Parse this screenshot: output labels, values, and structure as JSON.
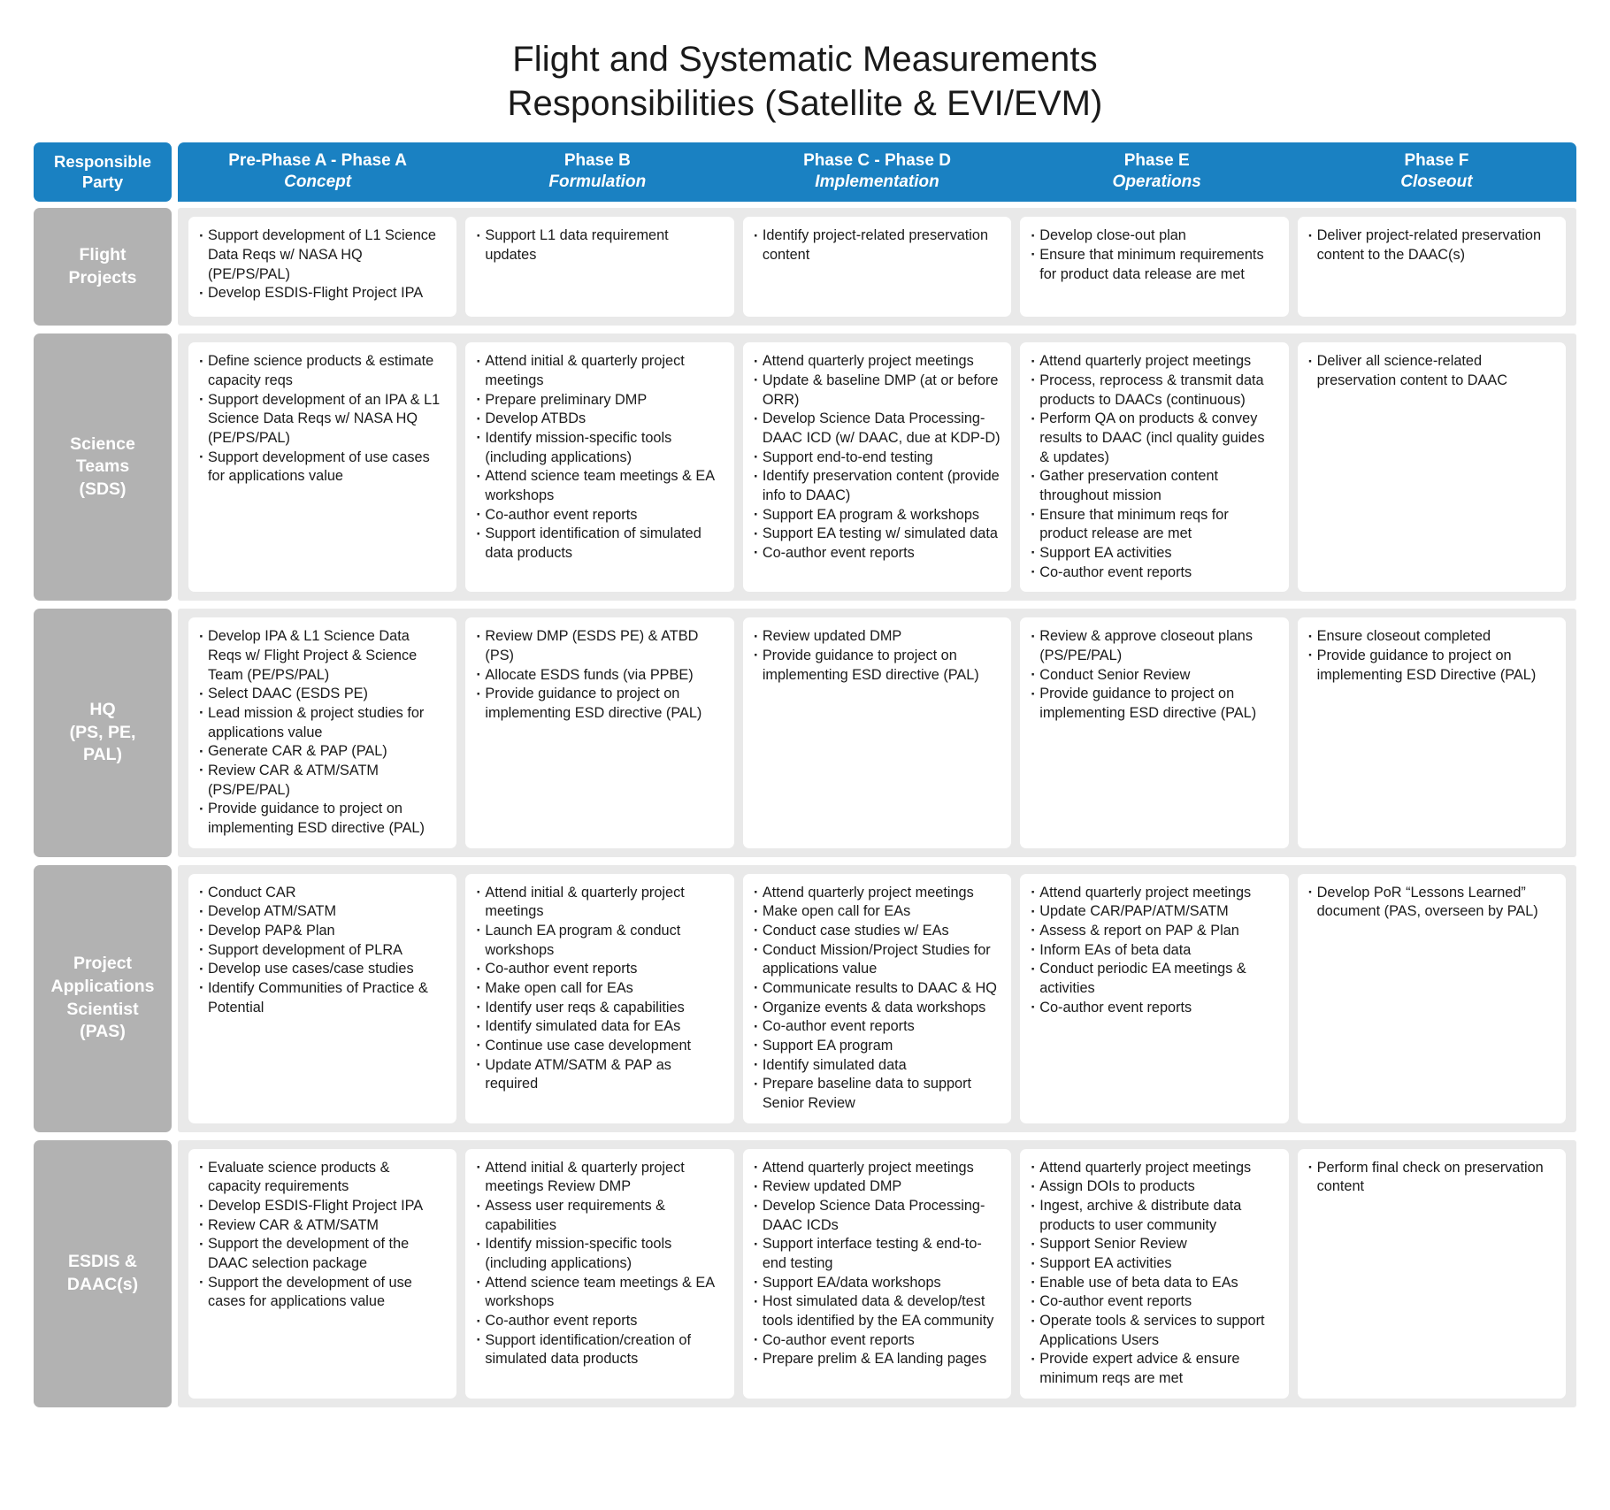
{
  "title": {
    "line1": "Flight and Systematic Measurements",
    "line2": "Responsibilities (Satellite & EVI/EVM)"
  },
  "colors": {
    "header_blue": "#1a81c2",
    "row_label_gray": "#b2b2b2",
    "cell_band_gray": "#e9e9e9",
    "cell_white": "#ffffff",
    "text_dark": "#1a1a1a"
  },
  "header": {
    "responsible_party_line1": "Responsible",
    "responsible_party_line2": "Party",
    "phases": [
      {
        "name": "Pre-Phase A - Phase A",
        "sub": "Concept"
      },
      {
        "name": "Phase B",
        "sub": "Formulation"
      },
      {
        "name": "Phase C - Phase D",
        "sub": "Implementation"
      },
      {
        "name": "Phase E",
        "sub": "Operations"
      },
      {
        "name": "Phase F",
        "sub": "Closeout"
      }
    ]
  },
  "rows": [
    {
      "label_lines": [
        "Flight",
        "Projects"
      ],
      "cells": [
        [
          "Support development of L1 Science Data Reqs w/ NASA HQ (PE/PS/PAL)",
          "Develop ESDIS-Flight Project IPA"
        ],
        [
          "Support L1 data requirement updates"
        ],
        [
          "Identify project-related preservation content"
        ],
        [
          "Develop close-out plan",
          "Ensure that minimum requirements for product data release are met"
        ],
        [
          "Deliver project-related preservation content to the DAAC(s)"
        ]
      ]
    },
    {
      "label_lines": [
        "Science",
        "Teams",
        "(SDS)"
      ],
      "cells": [
        [
          "Define science products & estimate capacity reqs",
          "Support development of an IPA & L1 Science Data Reqs w/ NASA HQ (PE/PS/PAL)",
          "Support development of use cases for applications value"
        ],
        [
          "Attend initial & quarterly project meetings",
          "Prepare preliminary DMP",
          "Develop ATBDs",
          "Identify mission-specific tools (including applications)",
          "Attend science team meetings & EA workshops",
          "Co-author event reports",
          "Support identification of simulated data products"
        ],
        [
          "Attend quarterly project meetings",
          "Update & baseline DMP (at or before ORR)",
          "Develop Science Data Processing-DAAC ICD (w/ DAAC, due at KDP-D)",
          "Support end-to-end testing",
          "Identify preservation content (provide info to DAAC)",
          "Support EA program & workshops",
          "Support EA testing w/ simulated data",
          "Co-author event reports"
        ],
        [
          "Attend quarterly project meetings",
          "Process, reprocess & transmit data products to DAACs (continuous)",
          "Perform QA on products & convey results to DAAC (incl quality guides & updates)",
          "Gather preservation content throughout mission",
          "Ensure that minimum reqs for product release are met",
          "Support EA activities",
          "Co-author event reports"
        ],
        [
          "Deliver all science-related preservation content to DAAC"
        ]
      ]
    },
    {
      "label_lines": [
        "HQ",
        "(PS, PE,",
        "PAL)"
      ],
      "cells": [
        [
          "Develop IPA & L1 Science Data Reqs w/ Flight Project & Science Team (PE/PS/PAL)",
          "Select DAAC (ESDS PE)",
          "Lead mission & project studies for applications value",
          "Generate CAR & PAP (PAL)",
          "Review CAR & ATM/SATM (PS/PE/PAL)",
          "Provide guidance to project on implementing ESD directive (PAL)"
        ],
        [
          " Review DMP (ESDS PE) & ATBD (PS)",
          "Allocate ESDS funds (via PPBE)",
          "Provide guidance to project on implementing ESD directive (PAL)"
        ],
        [
          "Review updated DMP",
          "Provide guidance to project on implementing ESD directive (PAL)"
        ],
        [
          "Review & approve closeout plans (PS/PE/PAL)",
          "Conduct Senior Review",
          "Provide guidance to project on implementing ESD directive (PAL)"
        ],
        [
          "Ensure closeout completed",
          "Provide guidance to project on implementing ESD Directive (PAL)"
        ]
      ]
    },
    {
      "label_lines": [
        "Project",
        "Applications",
        "Scientist",
        "(PAS)"
      ],
      "cells": [
        [
          "Conduct CAR",
          "Develop ATM/SATM",
          "Develop PAP& Plan",
          "Support development of PLRA",
          "Develop use cases/case studies",
          "Identify Communities of Practice & Potential"
        ],
        [
          "Attend initial & quarterly project meetings",
          "Launch EA program & conduct workshops",
          "Co-author event reports",
          "Make open call for EAs",
          "Identify user reqs & capabilities",
          "Identify simulated data for EAs",
          "Continue use case development",
          "Update ATM/SATM & PAP as required"
        ],
        [
          "Attend quarterly project meetings",
          "Make open call for EAs",
          "Conduct case studies w/ EAs",
          "Conduct Mission/Project Studies for applications value",
          "Communicate results to DAAC & HQ",
          "Organize events & data workshops",
          "Co-author event reports",
          "Support EA program",
          "Identify simulated data",
          "Prepare baseline data to support Senior Review"
        ],
        [
          "Attend quarterly project meetings",
          "Update CAR/PAP/ATM/SATM",
          "Assess & report on PAP & Plan",
          "Inform EAs of beta data",
          "Conduct periodic EA meetings & activities",
          "Co-author event reports"
        ],
        [
          "Develop PoR “Lessons Learned” document (PAS, overseen by PAL)"
        ]
      ]
    },
    {
      "label_lines": [
        "ESDIS &",
        "DAAC(s)"
      ],
      "cells": [
        [
          "Evaluate science products & capacity requirements",
          "Develop ESDIS-Flight Project IPA",
          "Review CAR & ATM/SATM",
          "Support the development of the DAAC selection package",
          "Support the development of use cases for applications value"
        ],
        [
          "Attend initial & quarterly project meetings Review DMP",
          "Assess user requirements & capabilities",
          "Identify mission-specific tools (including applications)",
          "Attend science team meetings & EA workshops",
          "Co-author event reports",
          "Support identification/creation of simulated data products"
        ],
        [
          "Attend quarterly project meetings",
          "Review updated DMP",
          "Develop Science Data Processing-DAAC ICDs",
          "Support interface testing & end-to-end testing",
          "Support EA/data workshops",
          "Host simulated data & develop/test tools identified by the EA community",
          "Co-author event reports",
          "Prepare prelim & EA landing pages"
        ],
        [
          "Attend quarterly project meetings",
          "Assign DOIs to products",
          "Ingest, archive & distribute data products to user community",
          "Support Senior Review",
          "Support EA activities",
          "Enable use of beta data to EAs",
          "Co-author event reports",
          "Operate tools & services to support Applications Users",
          "Provide expert advice & ensure minimum reqs are met"
        ],
        [
          "Perform final check on preservation content"
        ]
      ]
    }
  ]
}
